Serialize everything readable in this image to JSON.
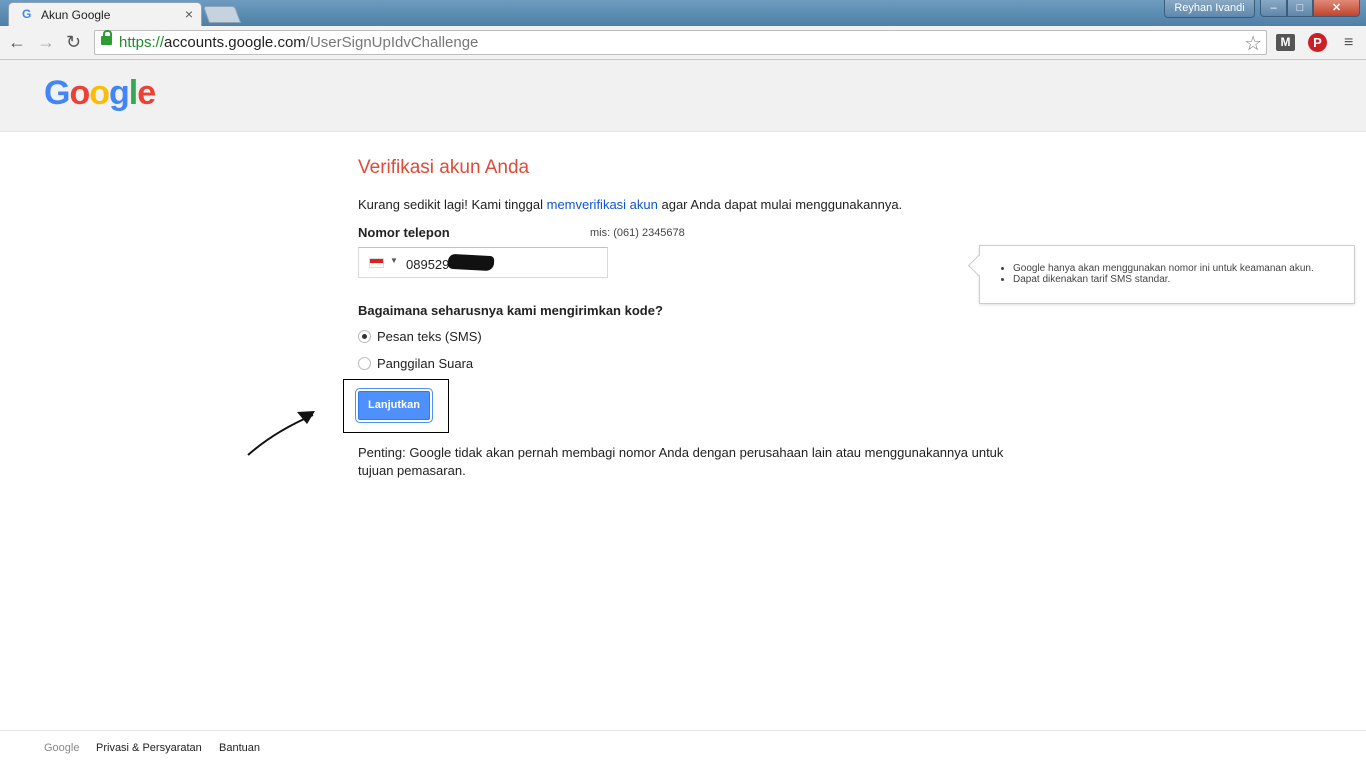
{
  "browser": {
    "tab_title": "Akun Google",
    "tab_favicon": "G",
    "tab_close": "×",
    "user_name": "Reyhan Ivandi",
    "window_controls": {
      "minimize": "–",
      "maximize": "□",
      "close": "✕"
    },
    "nav": {
      "back": "←",
      "forward": "→",
      "reload": "↻"
    },
    "url_scheme": "https://",
    "url_host": "accounts.google.com",
    "url_path": "/UserSignUpIdvChallenge",
    "star": "☆",
    "extensions": {
      "m": "M",
      "pinterest": "P"
    },
    "menu": "≡"
  },
  "header": {
    "logo_letters": [
      "G",
      "o",
      "o",
      "g",
      "l",
      "e"
    ]
  },
  "form": {
    "title": "Verifikasi akun Anda",
    "intro_before": "Kurang sedikit lagi! Kami tinggal ",
    "intro_link": "memverifikasi akun",
    "intro_after": " agar Anda dapat mulai menggunakannya.",
    "phone_label": "Nomor telepon",
    "phone_example": "mis: (061) 2345678",
    "phone_value": "089529",
    "question": "Bagaimana seharusnya kami mengirimkan kode?",
    "options": [
      {
        "label": "Pesan teks (SMS)",
        "selected": true
      },
      {
        "label": "Panggilan Suara",
        "selected": false
      }
    ],
    "continue_label": "Lanjutkan",
    "note": "Penting: Google tidak akan pernah membagi nomor Anda dengan perusahaan lain atau menggunakannya untuk tujuan pemasaran."
  },
  "tooltip": {
    "items": [
      "Google hanya akan menggunakan nomor ini untuk keamanan akun.",
      "Dapat dikenakan tarif SMS standar."
    ]
  },
  "footer": {
    "brand": "Google",
    "privacy": "Privasi & Persyaratan",
    "help": "Bantuan"
  }
}
